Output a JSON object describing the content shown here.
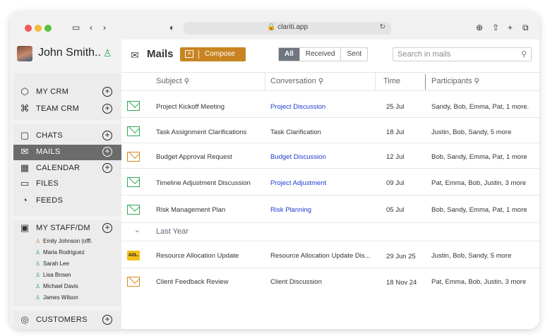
{
  "browser": {
    "url": "clariti.app",
    "icons": [
      "sidebar-icon",
      "back-icon",
      "forward-icon",
      "shield-icon",
      "lock-icon",
      "reload-icon",
      "download-icon",
      "share-icon",
      "new-tab-icon",
      "tabs-icon"
    ]
  },
  "sidebar": {
    "user_name": "John Smith..",
    "crm_items": [
      {
        "label": "MY CRM",
        "icon": "hexagon-icon"
      },
      {
        "label": "TEAM CRM",
        "icon": "network-icon"
      }
    ],
    "nav_items": [
      {
        "label": "CHATS",
        "icon": "chat-icon"
      },
      {
        "label": "MAILS",
        "icon": "mail-icon"
      },
      {
        "label": "CALENDAR",
        "icon": "calendar-icon"
      },
      {
        "label": "FILES",
        "icon": "folder-icon"
      },
      {
        "label": "FEEDS",
        "icon": "rss-icon"
      }
    ],
    "staff_header": "MY STAFF/DM",
    "staff": [
      {
        "name": "Emily Johnson",
        "status": "(offl."
      },
      {
        "name": "Maria Rodriguez",
        "status": ""
      },
      {
        "name": "Sarah Lee",
        "status": ""
      },
      {
        "name": "Lisa Brown",
        "status": ""
      },
      {
        "name": "Michael Davis",
        "status": ""
      },
      {
        "name": "James Wilson",
        "status": ""
      }
    ],
    "customers_label": "CUSTOMERS"
  },
  "header": {
    "title": "Mails",
    "compose_label": "Compose",
    "filters": [
      "All",
      "Received",
      "Sent"
    ],
    "active_filter": "All",
    "search_placeholder": "Search in mails"
  },
  "table": {
    "columns": [
      "Subject",
      "Conversation",
      "Time",
      "Participants"
    ],
    "rows": [
      {
        "icon": "green-envelope-icon",
        "subject": "Project Kickoff Meeting",
        "conversation": "Project Discussion",
        "conv_link": true,
        "time": "25 Jul",
        "participants": "Sandy, Bob, Emma, Pat, 1 more."
      },
      {
        "icon": "green-envelope-icon",
        "subject": "Task Assignment Clarifications",
        "conversation": "Task Clarification",
        "conv_link": false,
        "time": "18 Jul",
        "participants": "Justin, Bob, Sandy, 5 more"
      },
      {
        "icon": "orange-sent-envelope-icon",
        "subject": "Budget Approval Request",
        "conversation": "Budget Discussion",
        "conv_link": true,
        "time": "12 Jul",
        "participants": "Bob, Sandy, Emma, Pat, 1 more"
      },
      {
        "icon": "green-envelope-icon",
        "subject": "Timeline Adjustment Discussion",
        "conversation": "Project Adjustment",
        "conv_link": true,
        "time": "09 Jul",
        "participants": "Pat, Emma,  Bob, Justin, 3 more"
      },
      {
        "icon": "green-envelope-icon",
        "subject": "Risk Management Plan",
        "conversation": "Risk Planning",
        "conv_link": true,
        "time": "05 Jul",
        "participants": "Bob, Sandy, Emma, Pat, 1 more"
      }
    ],
    "group_label": "Last Year",
    "group_rows": [
      {
        "icon": "aol-icon",
        "aol_text": "AOL.",
        "subject": "Resource Allocation Update",
        "conversation": "Resource Allocation Update Dis...",
        "conv_link": false,
        "time": "29 Jun 25",
        "participants": "Justin, Bob, Sandy, 5 more"
      },
      {
        "icon": "orange-sent-envelope-icon",
        "subject": "Client Feedback Review",
        "conversation": "Client Discussion",
        "conv_link": false,
        "time": "18 Nov 24",
        "participants": "Pat, Emma,  Bob, Justin, 3 more"
      }
    ]
  },
  "colors": {
    "accent": "#c98422",
    "active_nav": "#6b6b6b",
    "link": "#1d3ccf",
    "online": "#2eaa4a",
    "offline": "#e07a2c"
  }
}
